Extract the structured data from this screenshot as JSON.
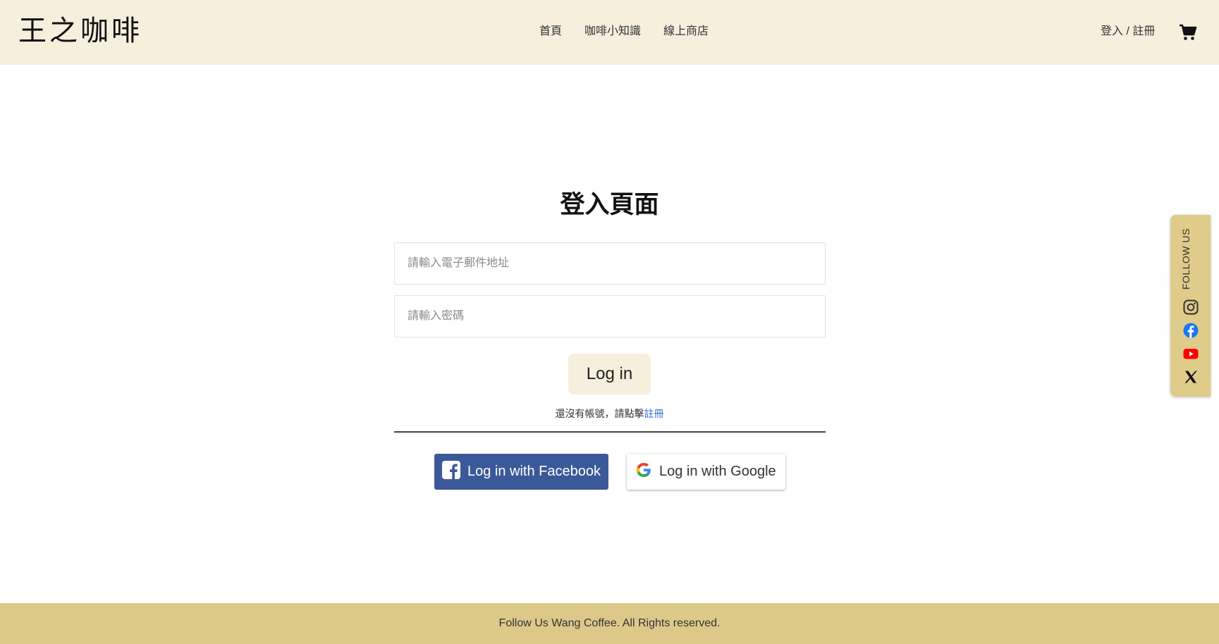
{
  "header": {
    "logo": "王之咖啡",
    "nav": [
      {
        "label": "首頁"
      },
      {
        "label": "咖啡小知識"
      },
      {
        "label": "線上商店"
      }
    ],
    "auth_link": "登入 / 註冊",
    "cart_icon": "cart-icon"
  },
  "login": {
    "title": "登入頁面",
    "email_placeholder": "請輸入電子郵件地址",
    "password_placeholder": "請輸入密碼",
    "submit_label": "Log in",
    "register_prompt": "還沒有帳號，請點擊",
    "register_link": "註冊",
    "facebook_label": "Log in with Facebook",
    "google_label": "Log in with Google"
  },
  "social": {
    "label": "FOLLOW US",
    "icons": [
      "instagram-icon",
      "facebook-icon",
      "youtube-icon",
      "x-icon"
    ]
  },
  "footer": {
    "text": "Follow Us Wang Coffee. All Rights reserved."
  },
  "colors": {
    "header_bg": "#f6efdc",
    "footer_bg": "#dcc98a",
    "facebook_blue": "#3b5998",
    "link_blue": "#2f6ad0"
  }
}
